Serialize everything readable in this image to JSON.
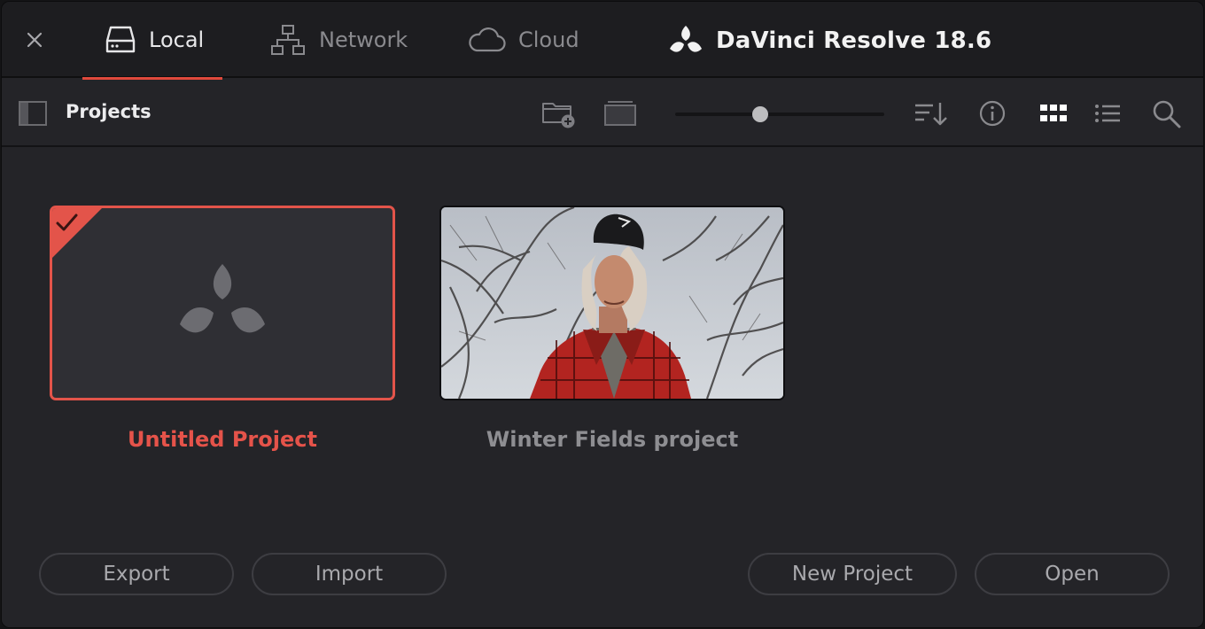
{
  "app": {
    "title": "DaVinci Resolve 18.6"
  },
  "tabs": [
    {
      "label": "Local",
      "icon": "drive-icon",
      "active": true
    },
    {
      "label": "Network",
      "icon": "network-icon",
      "active": false
    },
    {
      "label": "Cloud",
      "icon": "cloud-icon",
      "active": false
    }
  ],
  "toolbar": {
    "section_title": "Projects",
    "thumbnail_size": 0.4
  },
  "projects": [
    {
      "name": "Untitled Project",
      "selected": true,
      "thumbnail": "davinci-placeholder"
    },
    {
      "name": "Winter Fields project",
      "selected": false,
      "thumbnail": "man-in-winter-hat-photo"
    }
  ],
  "buttons": {
    "export": "Export",
    "import": "Import",
    "new_project": "New Project",
    "open": "Open"
  },
  "colors": {
    "accent": "#e0493c",
    "background": "#242428",
    "topbar": "#1d1d20"
  }
}
